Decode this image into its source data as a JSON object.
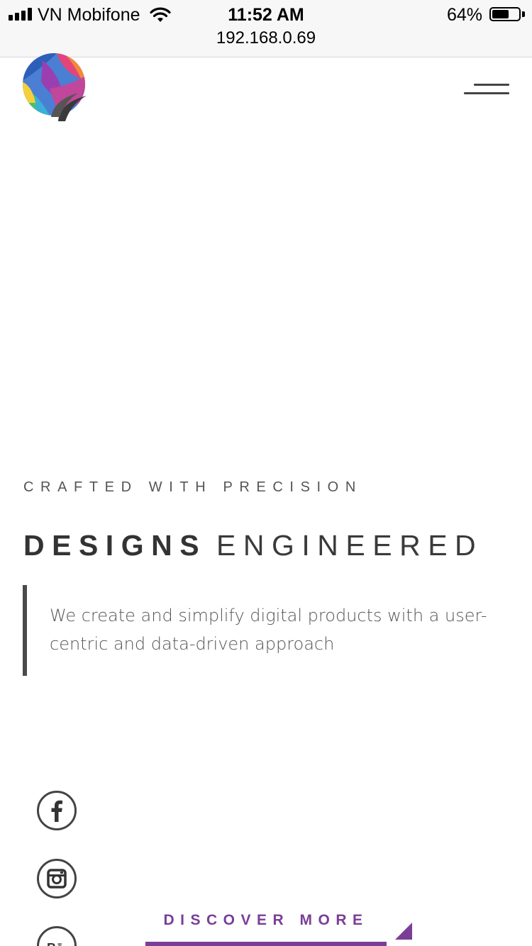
{
  "status_bar": {
    "carrier": "VN Mobifone",
    "time": "11:52 AM",
    "battery_percent": "64%",
    "battery_level": 0.64,
    "url": "192.168.0.69",
    "icons": [
      "signal-icon",
      "wifi-icon",
      "battery-icon"
    ]
  },
  "header": {
    "logo": "brand-logo",
    "menu_icon": "hamburger-menu-icon"
  },
  "hero": {
    "eyebrow": "CRAFTED WITH PRECISION",
    "headline_bold": "DESIGNS",
    "headline_light": "ENGINEERED",
    "description": "We create and simplify digital products with a user-centric and data-driven approach"
  },
  "social": [
    {
      "icon": "facebook-icon"
    },
    {
      "icon": "instagram-icon"
    },
    {
      "icon": "behance-icon"
    }
  ],
  "cta": {
    "label": "DISCOVER MORE"
  },
  "colors": {
    "accent": "#7b3e97",
    "text_dark": "#333333",
    "status_bar_bg": "#f7f7f7"
  }
}
